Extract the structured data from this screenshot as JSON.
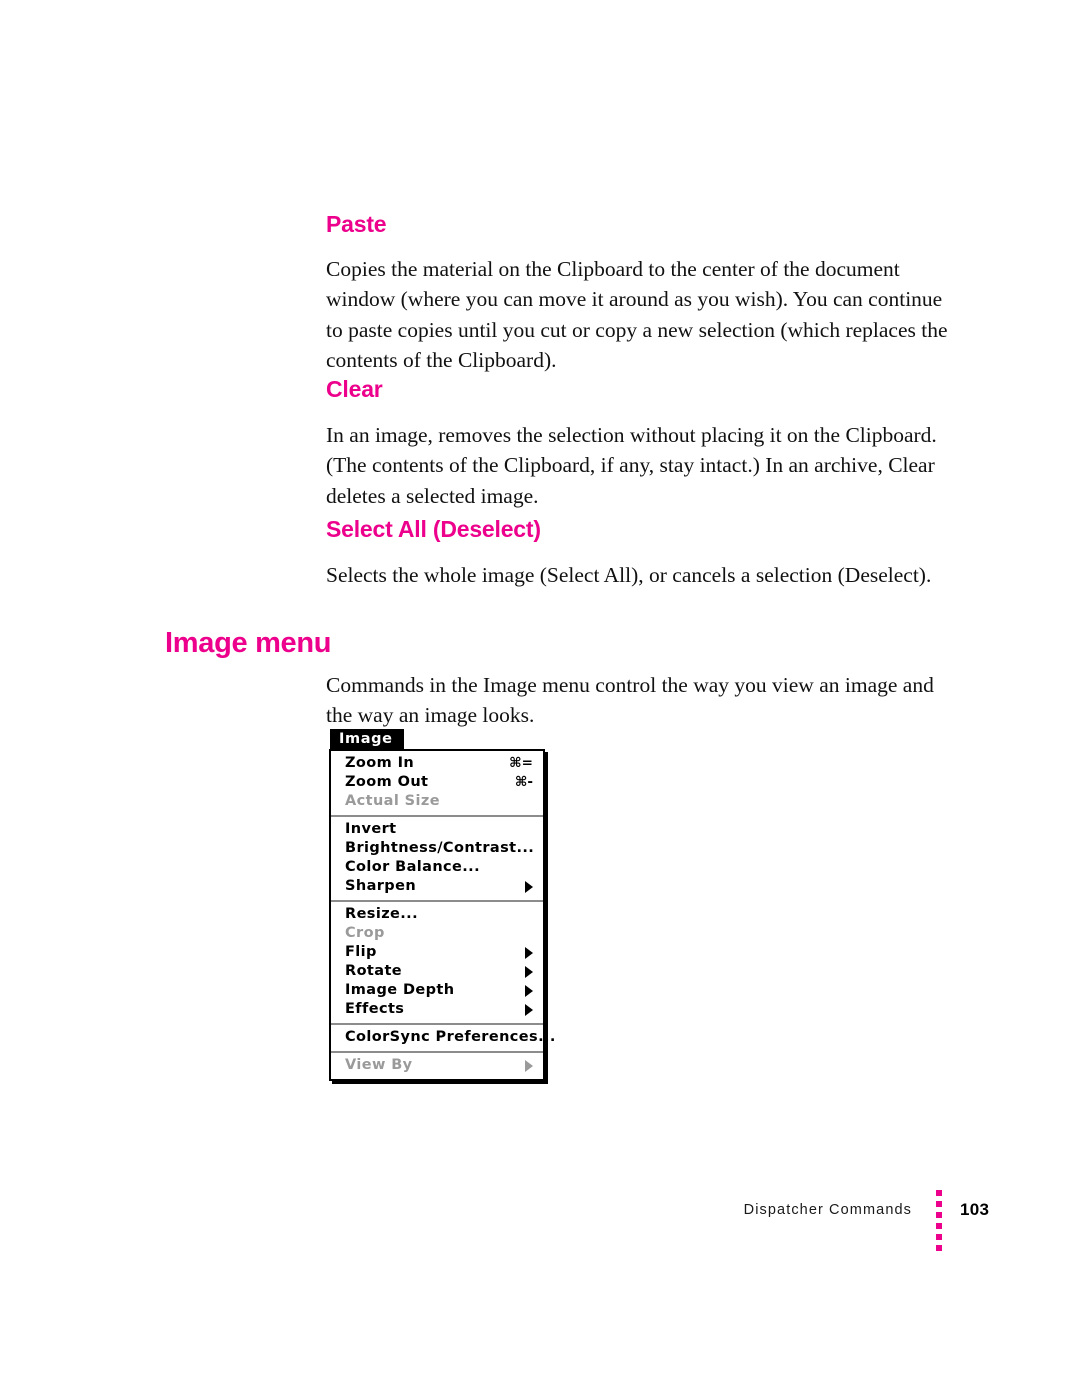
{
  "sections": [
    {
      "heading": "Paste",
      "body": "Copies the material on the Clipboard to the center of the document window (where you can move it around as you wish). You can continue to paste copies until you cut or copy a new selection (which replaces the contents of the Clipboard)."
    },
    {
      "heading": "Clear",
      "body": "In an image, removes the selection without placing it on the Clipboard. (The contents of the Clipboard, if any, stay intact.) In an archive, Clear deletes a selected image."
    },
    {
      "heading": "Select All (Deselect)",
      "body": "Selects the whole image (Select All), or cancels a selection (Deselect)."
    }
  ],
  "chapter": {
    "heading": "Image menu",
    "body": "Commands in the Image menu control the way you view an image and the way an image looks."
  },
  "menu": {
    "title": "Image",
    "groups": [
      {
        "items": [
          {
            "label": "Zoom In",
            "shortcut": "⌘=",
            "disabled": false,
            "submenu": false
          },
          {
            "label": "Zoom Out",
            "shortcut": "⌘-",
            "disabled": false,
            "submenu": false
          },
          {
            "label": "Actual Size",
            "shortcut": "",
            "disabled": true,
            "submenu": false
          }
        ]
      },
      {
        "items": [
          {
            "label": "Invert",
            "shortcut": "",
            "disabled": false,
            "submenu": false
          },
          {
            "label": "Brightness/Contrast...",
            "shortcut": "",
            "disabled": false,
            "submenu": false
          },
          {
            "label": "Color Balance...",
            "shortcut": "",
            "disabled": false,
            "submenu": false
          },
          {
            "label": "Sharpen",
            "shortcut": "",
            "disabled": false,
            "submenu": true
          }
        ]
      },
      {
        "items": [
          {
            "label": "Resize...",
            "shortcut": "",
            "disabled": false,
            "submenu": false
          },
          {
            "label": "Crop",
            "shortcut": "",
            "disabled": true,
            "submenu": false
          },
          {
            "label": "Flip",
            "shortcut": "",
            "disabled": false,
            "submenu": true
          },
          {
            "label": "Rotate",
            "shortcut": "",
            "disabled": false,
            "submenu": true
          },
          {
            "label": "Image Depth",
            "shortcut": "",
            "disabled": false,
            "submenu": true
          },
          {
            "label": "Effects",
            "shortcut": "",
            "disabled": false,
            "submenu": true
          }
        ]
      },
      {
        "items": [
          {
            "label": "ColorSync Preferences...",
            "shortcut": "",
            "disabled": false,
            "submenu": false
          }
        ]
      },
      {
        "items": [
          {
            "label": "View By",
            "shortcut": "",
            "disabled": true,
            "submenu": true
          }
        ]
      }
    ]
  },
  "footer": {
    "label": "Dispatcher Commands",
    "page_number": "103",
    "dot_count": 6
  },
  "colors": {
    "accent": "#EC008C",
    "text": "#111111",
    "menu_disabled": "#9A9A9A"
  }
}
